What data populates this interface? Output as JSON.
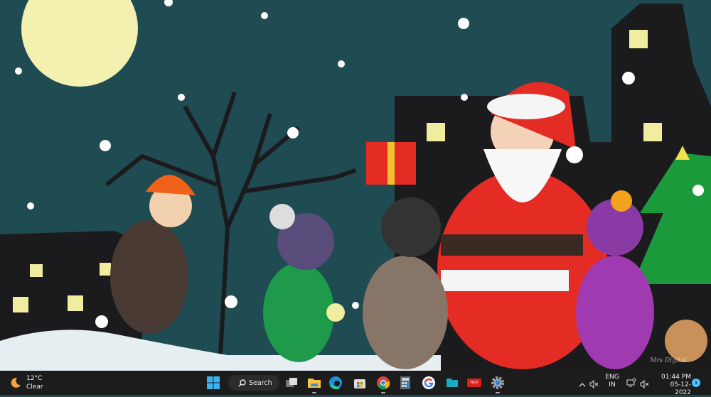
{
  "weather": {
    "temperature": "12°C",
    "condition": "Clear"
  },
  "search": {
    "label": "Search"
  },
  "taskbar_apps": [
    {
      "name": "start"
    },
    {
      "name": "task-view"
    },
    {
      "name": "file-explorer"
    },
    {
      "name": "edge"
    },
    {
      "name": "microsoft-store"
    },
    {
      "name": "chrome"
    },
    {
      "name": "calculator"
    },
    {
      "name": "google"
    },
    {
      "name": "folder"
    },
    {
      "name": "red-app"
    },
    {
      "name": "settings"
    }
  ],
  "red_app_label": "HUD",
  "tray": {
    "language": "ENG",
    "region": "IN",
    "time": "01:44 PM",
    "date": "05-12-2022",
    "notifications": "1"
  },
  "wallpaper_signature": "Mrs Digital"
}
